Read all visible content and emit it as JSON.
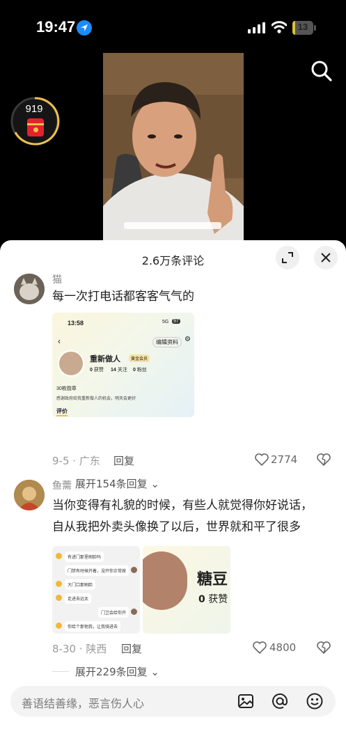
{
  "status_bar": {
    "time": "19:47",
    "battery": "13",
    "battery_level": 0.13
  },
  "coin_widget": {
    "count": "919"
  },
  "sheet": {
    "title": "2.6万条评论"
  },
  "comments": [
    {
      "username": "猫",
      "text": "每一次打电话都客客气气的",
      "date_location": "9-5 · 广东",
      "reply_label": "回复",
      "likes": "2774",
      "expand_replies": "展开154条回复",
      "image": {
        "time": "13:58",
        "signal": "5G",
        "battery": "97",
        "edit_profile": "编辑资料",
        "name": "重新做人",
        "member_badge": "黄金会员",
        "stats": [
          {
            "num": "0",
            "label": "获赞"
          },
          {
            "num": "14",
            "label": "关注"
          },
          {
            "num": "0",
            "label": "粉丝"
          }
        ],
        "medals": "30枚勋章",
        "bio": "感谢政府给我重新做人的机会，明天会更好",
        "tab": "评价"
      }
    },
    {
      "username": "鱼薷",
      "text_line1": "当你变得有礼貌的时候，有些人就觉得你好说话，",
      "text_line2": "自从我把外卖头像换了以后，世界就和平了很多",
      "date_location": "8-30 · 陕西",
      "reply_label": "回复",
      "likes": "4800",
      "expand_replies": "展开229条回复",
      "chat_image": {
        "messages": [
          {
            "side": "left",
            "text": "有进门那里刷脸吗"
          },
          {
            "side": "right",
            "text": "门禁有时候开着，没开你正常按"
          },
          {
            "side": "left",
            "text": "大门口那刷脸"
          },
          {
            "side": "left",
            "text": "走进去远太"
          },
          {
            "side": "right",
            "text": "门卫会给你开"
          },
          {
            "side": "left",
            "text": "你给个那他我，让我骑进去"
          }
        ]
      },
      "profile_image": {
        "name": "糖豆",
        "stat_num": "0",
        "stat_label": "获赞"
      }
    }
  ],
  "input_bar": {
    "placeholder": "善语结善缘，恶言伤人心"
  }
}
